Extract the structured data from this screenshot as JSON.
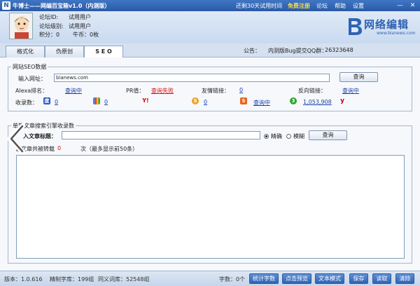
{
  "titlebar": {
    "app_title": "牛博士——网编百宝箱v1.0（内测版）",
    "trial_text": "还剩30天试用时间",
    "register_text": "免费注册",
    "menu": [
      "论坛",
      "帮助",
      "设置"
    ],
    "win_controls": [
      "—",
      "✕"
    ]
  },
  "user": {
    "forum_id_label": "论坛ID:",
    "forum_id_value": "试用用户",
    "forum_level_label": "论坛级别:",
    "forum_level_value": "试用用户",
    "points_text": "积分：0",
    "coins_text": "牛币：0枚"
  },
  "logo": {
    "name": "网络编辑",
    "url": "www.bianews.com"
  },
  "tabs": [
    "格式化",
    "伪原创",
    "S E O"
  ],
  "announcement": {
    "label": "公告：",
    "text": "内测版Bug提交QQ群：",
    "qq": "26323648"
  },
  "seo": {
    "group_title": "网站SEO数据",
    "url_label": "输入网址：",
    "url_value": "bianews.com",
    "query_button": "查询",
    "alexa_label": "Alexa排名：",
    "alexa_value": "查询中",
    "pr_label": "PR值：",
    "pr_value": "查询失败",
    "friend_label": "友情链接：",
    "friend_value": "0",
    "backlink_label": "反向链接：",
    "backlink_value": "查询中",
    "indexed_label": "收录数：",
    "indexed": [
      {
        "icon": "baidu-icon",
        "value": "0"
      },
      {
        "icon": "google-icon",
        "value": "0"
      },
      {
        "icon": "yahoo-icon",
        "value": ""
      },
      {
        "icon": "sogou-icon",
        "value": "0"
      },
      {
        "icon": "soso-icon",
        "value": "查询中"
      },
      {
        "icon": "360-icon",
        "value": "1,053,908"
      },
      {
        "icon": "youdao-icon",
        "value": ""
      }
    ]
  },
  "article": {
    "group_title": "单篇文章搜索引擎收录数",
    "title_label": "入文章标题：",
    "title_value": "",
    "radio_exact": "精确",
    "radio_fuzzy": "模糊",
    "query_button": "查询",
    "repost_prefix": "该文章共被转载",
    "repost_count": "0",
    "repost_suffix": "次（最多显示前50条）"
  },
  "status": {
    "version": "版本：1.0.616",
    "dict": "精制字库：199组",
    "synonyms": "同义词库：52548组",
    "word_count_label": "字数：",
    "word_count": "0个",
    "buttons": [
      "统计字数",
      "点击预览",
      "文本模式",
      "保存",
      "读取",
      "清除"
    ]
  },
  "colors": {
    "accent": "#2f63b3",
    "link": "#1a3fa8",
    "alert": "#d11111"
  }
}
